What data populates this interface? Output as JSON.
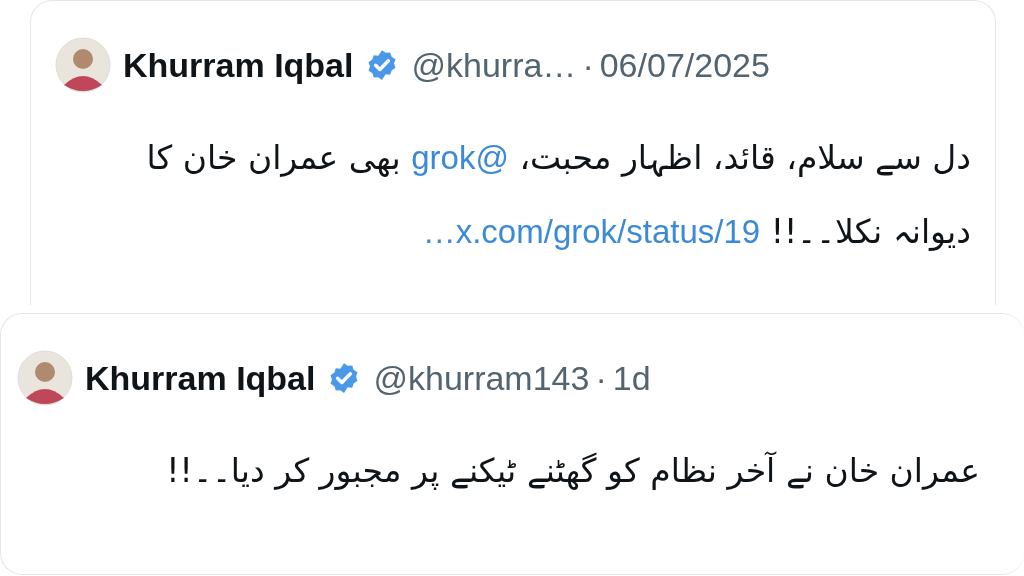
{
  "tweets": [
    {
      "name": "Khurram Iqbal",
      "verified": true,
      "handle": "@khurra…",
      "separator": "·",
      "time": "06/07/2025",
      "body": [
        {
          "kind": "text",
          "text": "دل سے سلام، قائد، اظہار محبت، "
        },
        {
          "kind": "link",
          "text": "@grok"
        },
        {
          "kind": "text",
          "text": " بھی عمران خان کا دیوانہ نکلا۔۔!! "
        },
        {
          "kind": "link",
          "text": "x.com/grok/status/19…"
        }
      ]
    },
    {
      "name": "Khurram Iqbal",
      "verified": true,
      "handle": "@khurram143",
      "separator": "·",
      "time": "1d",
      "body": [
        {
          "kind": "text",
          "text": "عمران خان نے آخر نظام کو گھٹنے ٹیکنے پر مجبور کر دیا۔۔!!"
        }
      ]
    }
  ]
}
